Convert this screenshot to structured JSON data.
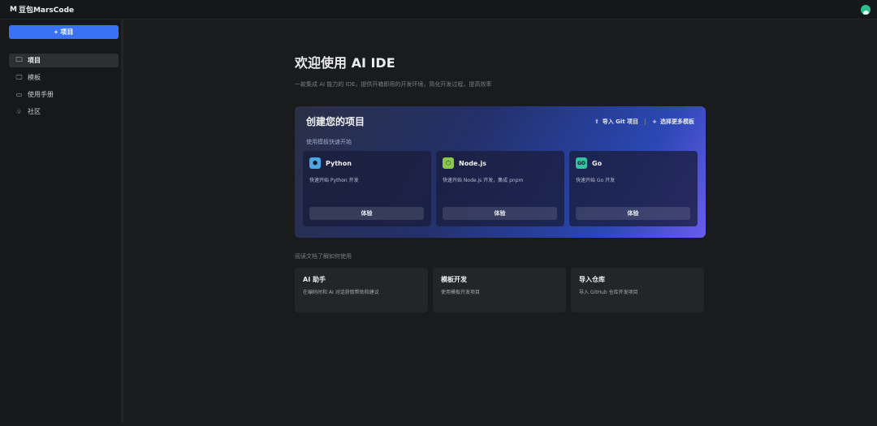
{
  "app": {
    "brand_mark": "M",
    "brand_name": "豆包MarsCode"
  },
  "sidebar": {
    "new_button": {
      "icon": "+",
      "label": "项目"
    },
    "items": [
      {
        "icon": "folder-icon",
        "glyph": "🗀",
        "label": "项目",
        "active": true
      },
      {
        "icon": "monitor-icon",
        "glyph": "🖵",
        "label": "模板",
        "active": false
      },
      {
        "icon": "book-icon",
        "glyph": "▭",
        "label": "使用手册",
        "active": false
      },
      {
        "icon": "community-icon",
        "glyph": "♧",
        "label": "社区",
        "active": false
      }
    ]
  },
  "main": {
    "title": "欢迎使用 AI IDE",
    "subtitle": "一款集成 AI 能力的 IDE，提供开箱即用的开发环境，简化开发过程，提高效率",
    "hero": {
      "title": "创建您的项目",
      "import_git": "导入 Git 项目",
      "more_templates": "选择更多模板",
      "hint": "使用模板快速开始",
      "cards": [
        {
          "name": "Python",
          "desc": "快速开始 Python 开发",
          "button": "体验",
          "icon": "python-icon",
          "glyph": "⬢",
          "color": "#4aa6e6"
        },
        {
          "name": "Node.js",
          "desc": "快速开始 Node.js 开发，集成 pnpm",
          "button": "体验",
          "icon": "nodejs-icon",
          "glyph": "⬡",
          "color": "#8cc84b"
        },
        {
          "name": "Go",
          "desc": "快速开始 Go 开发",
          "button": "体验",
          "icon": "go-icon",
          "glyph": "GO",
          "color": "#33c3a5"
        }
      ]
    },
    "docs_hint": "阅读文档了解如何使用",
    "docs": [
      {
        "title": "AI 助手",
        "desc": "在编码时和 AI 对话获取帮助和建议"
      },
      {
        "title": "模板开发",
        "desc": "使用模板开发项目"
      },
      {
        "title": "导入仓库",
        "desc": "导入 GitHub 仓库开发项目"
      }
    ]
  },
  "colors": {
    "accent": "#3a72f6",
    "avatar": "#2bbd8a"
  }
}
